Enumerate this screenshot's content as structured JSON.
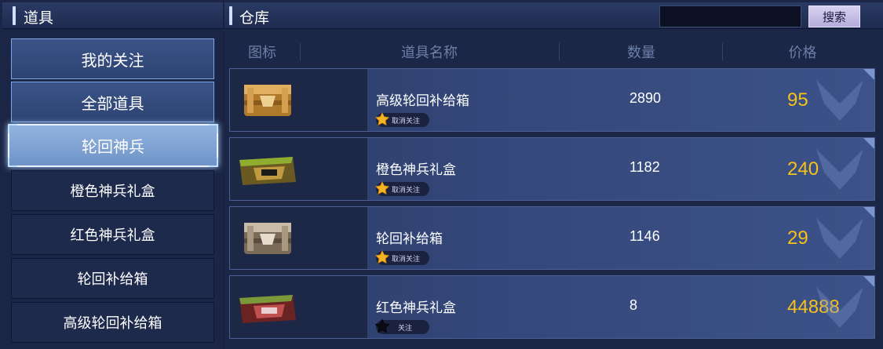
{
  "left_panel": {
    "title": "道具",
    "categories": [
      {
        "label": "我的关注",
        "state": "top"
      },
      {
        "label": "全部道具",
        "state": "top"
      },
      {
        "label": "轮回神兵",
        "state": "active"
      },
      {
        "label": "橙色神兵礼盒",
        "state": "normal"
      },
      {
        "label": "红色神兵礼盒",
        "state": "normal"
      },
      {
        "label": "轮回补给箱",
        "state": "normal"
      },
      {
        "label": "高级轮回补给箱",
        "state": "normal"
      }
    ]
  },
  "right_panel": {
    "title": "仓库",
    "search": {
      "value": "",
      "button_label": "搜索"
    },
    "columns": [
      "图标",
      "道具名称",
      "数量",
      "价格"
    ],
    "items": [
      {
        "name": "高级轮回补给箱",
        "quantity": "2890",
        "price": "95",
        "fav_label": "取消关注",
        "favorited": true,
        "icon": "gold-crate-icon"
      },
      {
        "name": "橙色神兵礼盒",
        "quantity": "1182",
        "price": "240",
        "fav_label": "取消关注",
        "favorited": true,
        "icon": "orange-gift-box-icon"
      },
      {
        "name": "轮回补给箱",
        "quantity": "1146",
        "price": "29",
        "fav_label": "取消关注",
        "favorited": true,
        "icon": "silver-crate-icon"
      },
      {
        "name": "红色神兵礼盒",
        "quantity": "8",
        "price": "44888",
        "fav_label": "关注",
        "favorited": false,
        "icon": "red-gift-box-icon"
      }
    ]
  },
  "colors": {
    "price": "#f6c21a",
    "star_active": "#f5b321",
    "star_inactive": "#0a0a14"
  }
}
